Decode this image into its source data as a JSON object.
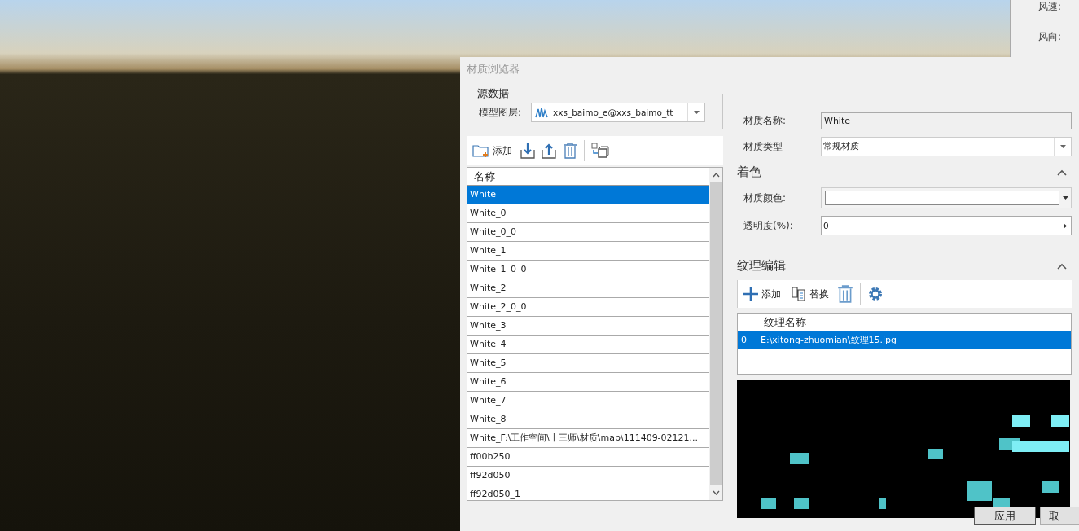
{
  "weather_panel": {
    "labels": [
      "风速:",
      "风向:"
    ]
  },
  "dialog": {
    "title": "材质浏览器",
    "source_data": {
      "legend": "源数据",
      "layer_label": "模型图层:",
      "layer_value": "xxs_baimo_e@xxs_baimo_tt"
    },
    "material_toolbar": {
      "add_label": "添加"
    },
    "material_list": {
      "column": "名称",
      "rows": [
        {
          "name": "White",
          "selected": true
        },
        {
          "name": "White_0",
          "selected": false
        },
        {
          "name": "White_0_0",
          "selected": false
        },
        {
          "name": "White_1",
          "selected": false
        },
        {
          "name": "White_1_0_0",
          "selected": false
        },
        {
          "name": "White_2",
          "selected": false
        },
        {
          "name": "White_2_0_0",
          "selected": false
        },
        {
          "name": "White_3",
          "selected": false
        },
        {
          "name": "White_4",
          "selected": false
        },
        {
          "name": "White_5",
          "selected": false
        },
        {
          "name": "White_6",
          "selected": false
        },
        {
          "name": "White_7",
          "selected": false
        },
        {
          "name": "White_8",
          "selected": false
        },
        {
          "name": "White_F:\\工作空间\\十三师\\材质\\map\\111409-02121...",
          "selected": false
        },
        {
          "name": "ff00b250",
          "selected": false
        },
        {
          "name": "ff92d050",
          "selected": false
        },
        {
          "name": "ff92d050_1",
          "selected": false
        }
      ]
    },
    "properties": {
      "name_label": "材质名称:",
      "name_value": "White",
      "type_label": "材质类型",
      "type_value": "常规材质"
    },
    "coloring": {
      "title": "着色",
      "expanded": true,
      "color_label": "材质颜色:",
      "transparency_label": "透明度(%):",
      "transparency_value": "0"
    },
    "texture": {
      "title": "纹理编辑",
      "expanded": true,
      "add_label": "添加",
      "replace_label": "替换",
      "column": "纹理名称",
      "rows": [
        {
          "index": "0",
          "name": "E:\\xitong-zhuomian\\纹理15.jpg",
          "selected": true
        }
      ]
    },
    "buttons": [
      "应用",
      "取"
    ]
  }
}
